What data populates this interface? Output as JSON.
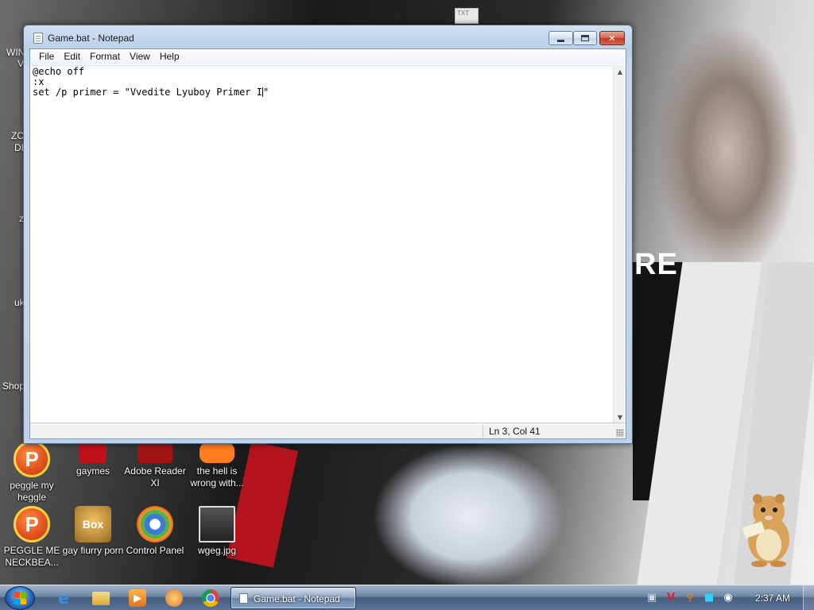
{
  "desktop": {
    "partial_labels": [
      "WIN",
      "V",
      "ZO",
      "DE",
      "z",
      "uk",
      "Shop"
    ],
    "top_right_thumbnail": "TXT",
    "wallpaper_text": "RE",
    "icons": [
      {
        "label": "peggle my heggle",
        "icon": "peggle-icon"
      },
      {
        "label": "gaymes",
        "icon": "gaymes-icon"
      },
      {
        "label": "Adobe Reader XI",
        "icon": "adobe-reader-icon"
      },
      {
        "label": "the hell is wrong with...",
        "icon": "aol-icon"
      },
      {
        "label": "PEGGLE ME NECKBEA...",
        "icon": "peggle-icon"
      },
      {
        "label": "gay fiurry porn",
        "icon": "box-icon",
        "badge": "Box"
      },
      {
        "label": "Control Panel",
        "icon": "control-panel-icon"
      },
      {
        "label": "wgeg.jpg",
        "icon": "image-file-icon"
      }
    ]
  },
  "window": {
    "title": "Game.bat - Notepad",
    "menu": [
      "File",
      "Edit",
      "Format",
      "View",
      "Help"
    ],
    "content_lines": [
      "@echo off",
      ":x",
      "set /p primer = \"Vvedite Lyuboy Primer I"
    ],
    "content_after_caret": "\"",
    "status": "Ln 3, Col 41"
  },
  "taskbar": {
    "pinned": [
      "internet-explorer-icon",
      "folder-icon",
      "media-player-icon",
      "paint-icon",
      "chrome-icon"
    ],
    "active_task": "Game.bat - Notepad",
    "tray": [
      "V"
    ],
    "clock": "2:37 AM"
  }
}
